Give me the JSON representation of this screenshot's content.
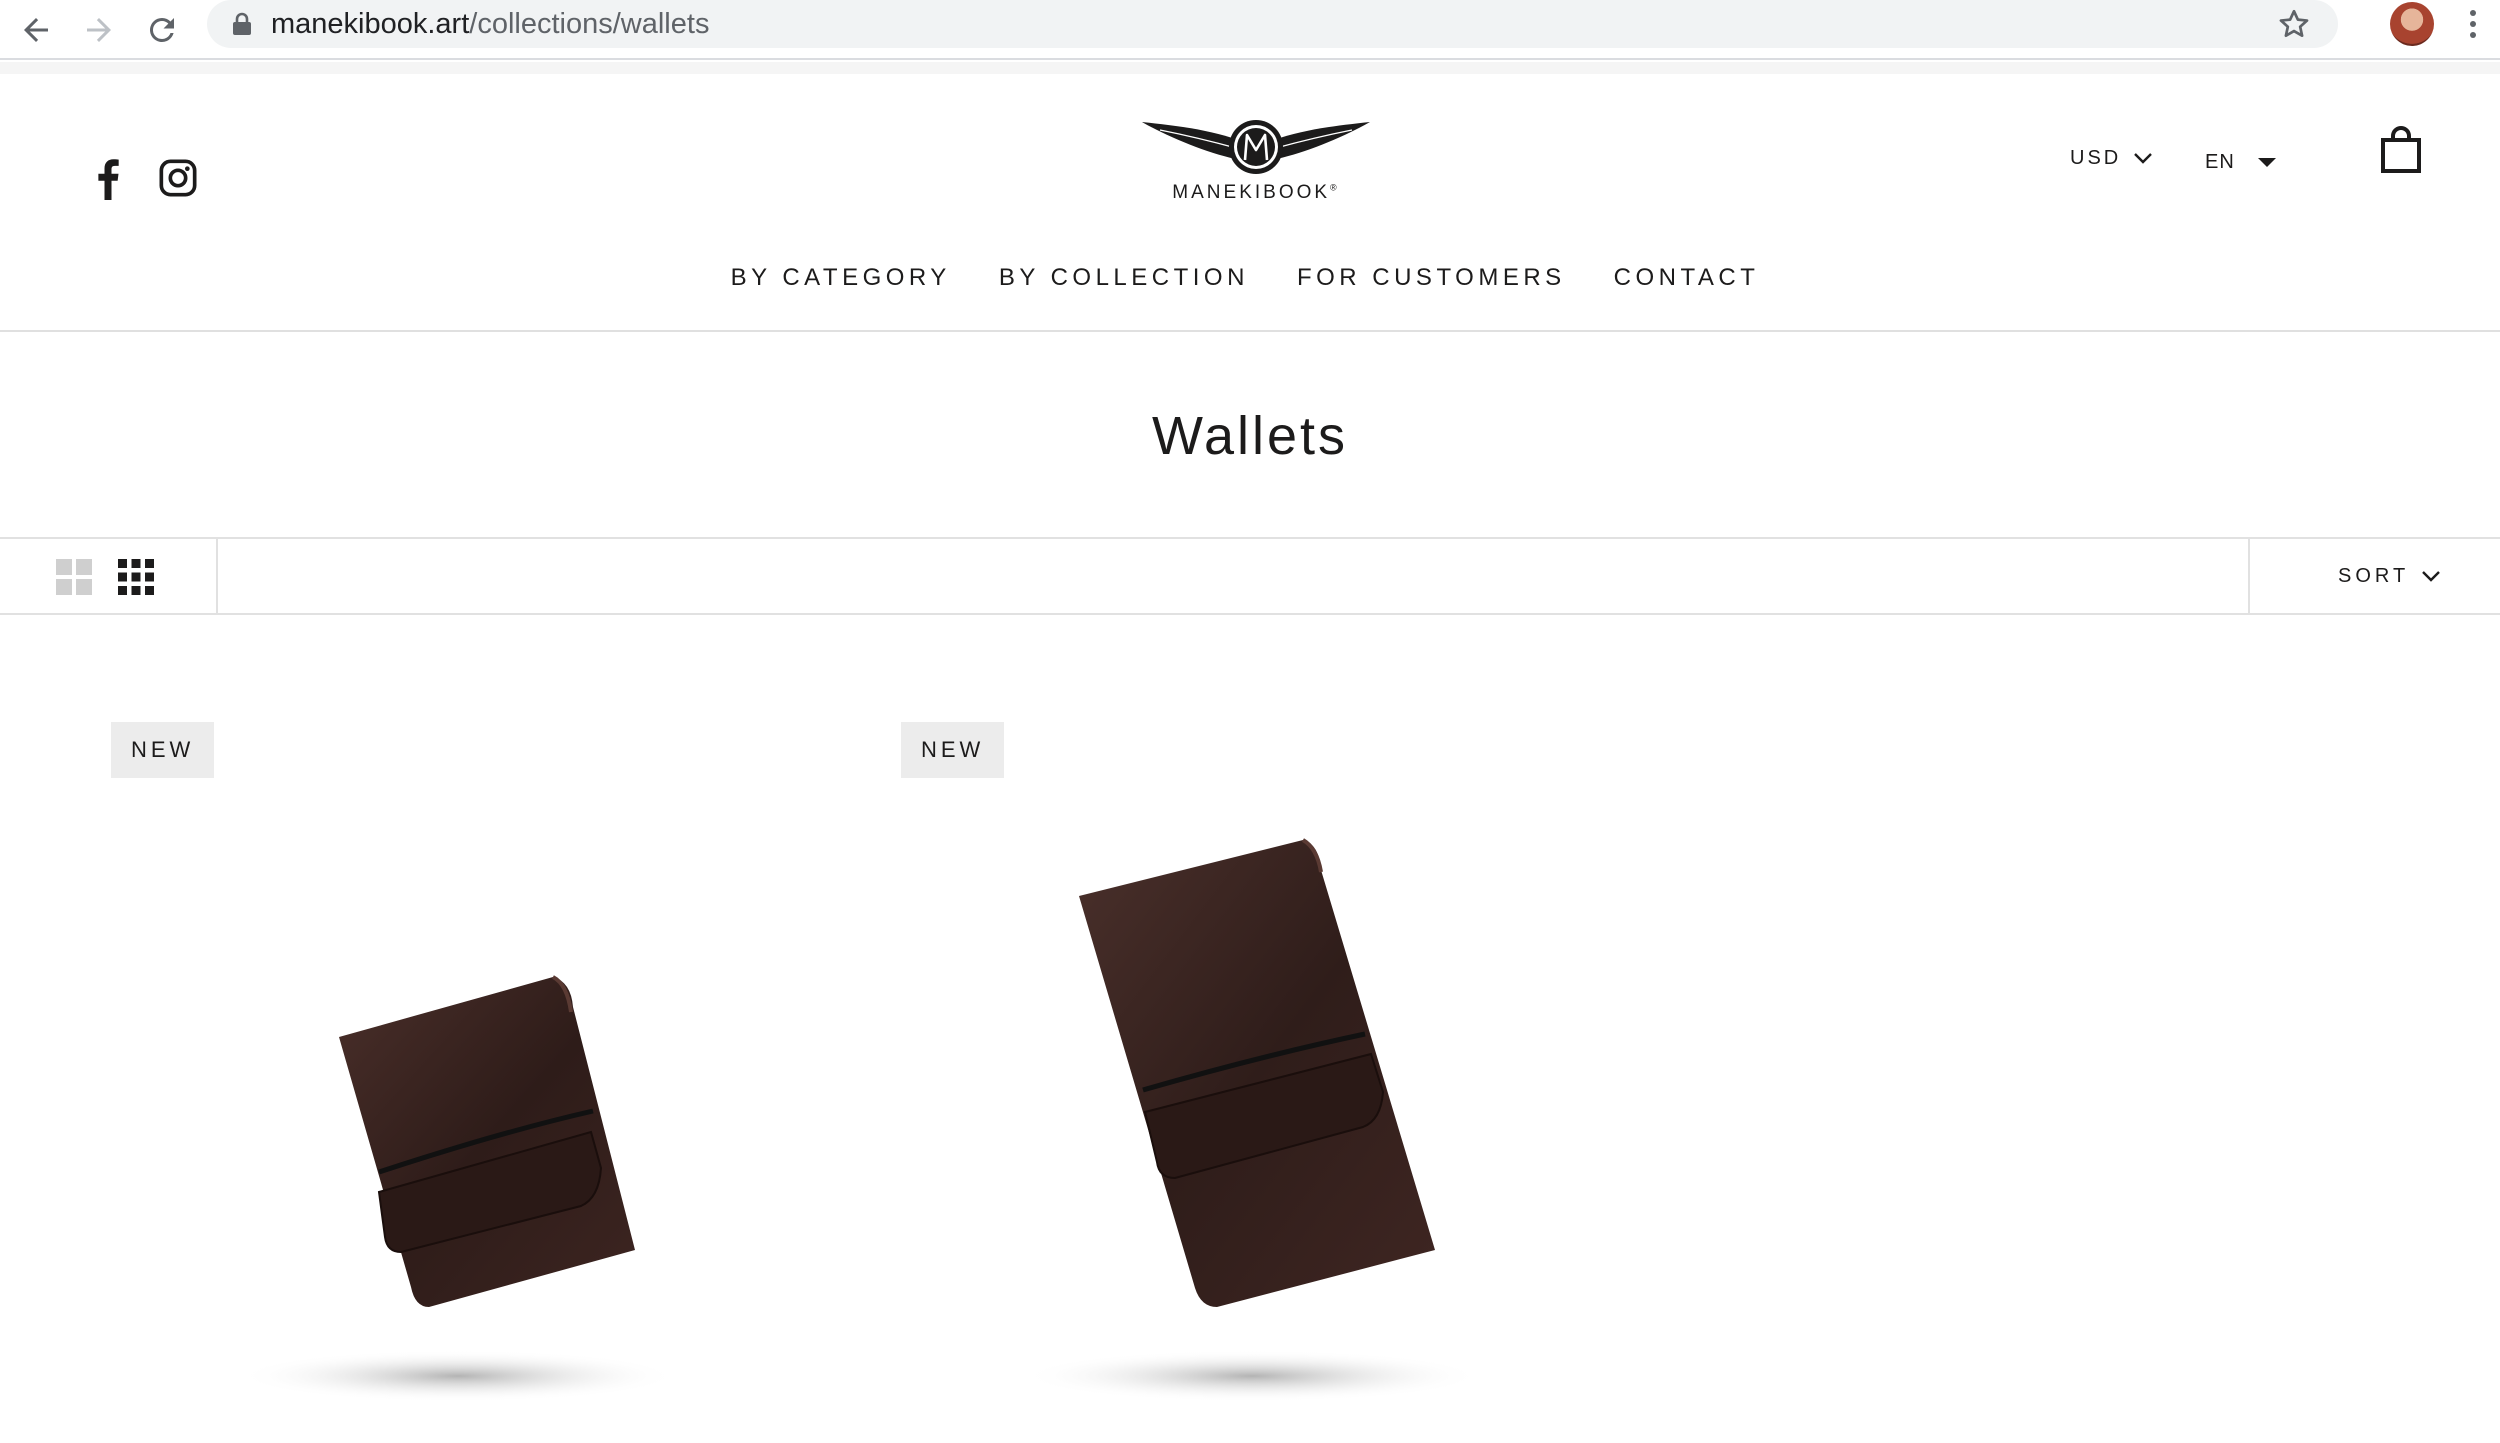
{
  "browser": {
    "url_domain": "manekibook.art",
    "url_path": "/collections/wallets",
    "back_icon": "back-arrow-icon",
    "forward_icon": "forward-arrow-icon",
    "reload_icon": "reload-icon",
    "lock_icon": "lock-icon",
    "bookmark_icon": "star-icon",
    "menu_icon": "kebab-menu-icon"
  },
  "header": {
    "social": [
      "facebook-icon",
      "instagram-icon"
    ],
    "logo_text": "MANEKIBOOK",
    "logo_mark": "®",
    "currency": "USD",
    "language": "EN",
    "cart_icon": "shopping-bag-icon"
  },
  "nav": {
    "items": [
      "BY CATEGORY",
      "BY COLLECTION",
      "FOR CUSTOMERS",
      "CONTACT"
    ]
  },
  "collection": {
    "title": "Wallets"
  },
  "toolbar": {
    "view_options": [
      "grid-large-icon",
      "grid-small-icon"
    ],
    "active_view": "grid-small",
    "sort_label": "SORT"
  },
  "products": [
    {
      "badge": "NEW",
      "image": "small-dark-brown-leather-wallet"
    },
    {
      "badge": "NEW",
      "image": "long-dark-brown-leather-wallet"
    }
  ],
  "colors": {
    "text": "#1c1b1b",
    "leather": "#3a2420",
    "badge_bg": "#ececec",
    "border": "#e1e1e1"
  }
}
